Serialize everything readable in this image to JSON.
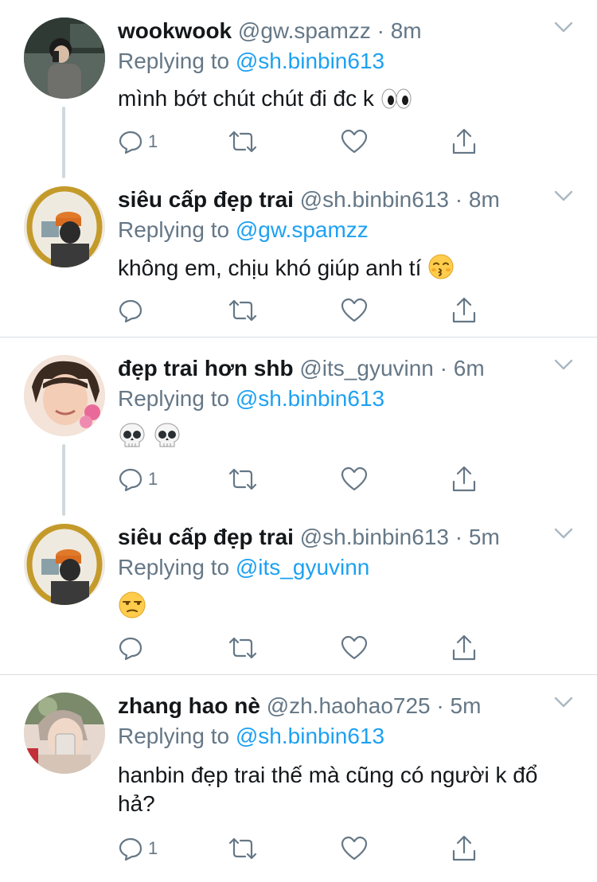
{
  "tweets": [
    {
      "name": "wookwook",
      "handle": "@gw.spamzz",
      "dot": "·",
      "time": "8m",
      "reply_prefix": "Replying to",
      "reply_to": "@sh.binbin613",
      "text": "mình bớt chút chút đi đc k",
      "emoji": "eyes",
      "reply_count": "1"
    },
    {
      "name": "siêu cấp đẹp trai",
      "handle": "@sh.binbin613",
      "dot": "·",
      "time": "8m",
      "reply_prefix": "Replying to",
      "reply_to": "@gw.spamzz",
      "text": "không em, chịu khó giúp anh tí",
      "emoji": "kissing-face",
      "reply_count": ""
    },
    {
      "name": "đẹp trai hơn shb",
      "handle": "@its_gyuvinn",
      "dot": "·",
      "time": "6m",
      "reply_prefix": "Replying to",
      "reply_to": "@sh.binbin613",
      "text": "",
      "emoji": "skull skull",
      "reply_count": "1"
    },
    {
      "name": "siêu cấp đẹp trai",
      "handle": "@sh.binbin613",
      "dot": "·",
      "time": "5m",
      "reply_prefix": "Replying to",
      "reply_to": "@its_gyuvinn",
      "text": "",
      "emoji": "unamused-face",
      "reply_count": ""
    },
    {
      "name": "zhang hao nè",
      "handle": "@zh.haohao725",
      "dot": "·",
      "time": "5m",
      "reply_prefix": "Replying to",
      "reply_to": "@sh.binbin613",
      "text": "hanbin đẹp trai thế mà cũng có người k đổ hả?",
      "emoji": "",
      "reply_count": "1"
    }
  ],
  "icons": {
    "reply": "reply-icon",
    "retweet": "retweet-icon",
    "like": "heart-icon",
    "share": "share-icon",
    "menu": "chevron-down-icon"
  },
  "colors": {
    "mention": "#1da1f2",
    "secondary_text": "#657786",
    "icon": "#657786",
    "thread_line": "#cfd9de"
  }
}
